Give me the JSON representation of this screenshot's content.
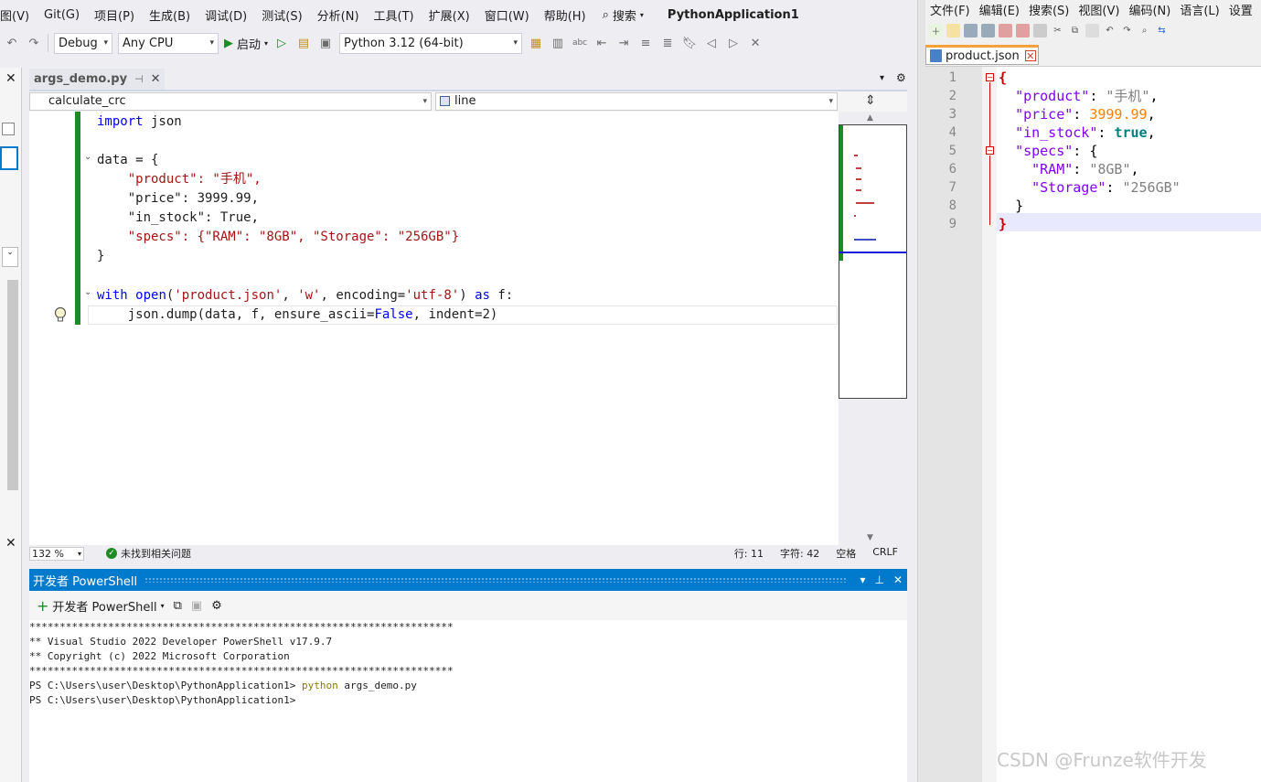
{
  "vs": {
    "menu": [
      "图(V)",
      "Git(G)",
      "项目(P)",
      "生成(B)",
      "调试(D)",
      "测试(S)",
      "分析(N)",
      "工具(T)",
      "扩展(X)",
      "窗口(W)",
      "帮助(H)"
    ],
    "search_label": "搜索",
    "solution_title": "PythonApplication1",
    "toolbar": {
      "config": "Debug",
      "platform": "Any CPU",
      "start": "启动",
      "python_env": "Python 3.12 (64-bit)"
    },
    "tab": {
      "file": "args_demo.py"
    },
    "nav": {
      "scope": "calculate_crc",
      "member": "line"
    },
    "code": {
      "l1": [
        "import",
        " json"
      ],
      "l2": "data = {",
      "l3": "    \"product\": \"手机\",",
      "l4": "    \"price\": 3999.99,",
      "l5": "    \"in_stock\": True,",
      "l6": "    \"specs\": {\"RAM\": \"8GB\", \"Storage\": \"256GB\"}",
      "l7": "}",
      "l8": [
        "with",
        " ",
        "open",
        "(",
        "'product.json'",
        ", ",
        "'w'",
        ", encoding=",
        "'utf-8'",
        ") ",
        "as",
        " f:"
      ],
      "l9": [
        "    json.dump(data, f, ensure_ascii=",
        "False",
        ", indent=2)"
      ]
    },
    "status": {
      "zoom": "132 %",
      "issues": "未找到相关问题",
      "line": "行: 11",
      "char": "字符: 42",
      "spaces": "空格",
      "eol": "CRLF"
    },
    "terminal": {
      "title": "开发者 PowerShell",
      "new_label": "开发者 PowerShell",
      "lines": [
        "**********************************************************************",
        "** Visual Studio 2022 Developer PowerShell v17.9.7",
        "** Copyright (c) 2022 Microsoft Corporation",
        "**********************************************************************"
      ],
      "prompt1": "PS C:\\Users\\user\\Desktop\\PythonApplication1> ",
      "cmd1": "python",
      "cmd1_arg": " args_demo.py",
      "prompt2": "PS C:\\Users\\user\\Desktop\\PythonApplication1>"
    }
  },
  "npp": {
    "menu": [
      "文件(F)",
      "编辑(E)",
      "搜索(S)",
      "视图(V)",
      "编码(N)",
      "语言(L)",
      "设置"
    ],
    "tab": "product.json",
    "line_numbers": [
      "1",
      "2",
      "3",
      "4",
      "5",
      "6",
      "7",
      "8",
      "9"
    ],
    "json": {
      "l1": "{",
      "l2_key": "\"product\"",
      "l2_val": "\"手机\"",
      "l3_key": "\"price\"",
      "l3_val": "3999.99",
      "l4_key": "\"in_stock\"",
      "l4_val": "true",
      "l5_key": "\"specs\"",
      "l6_key": "\"RAM\"",
      "l6_val": "\"8GB\"",
      "l7_key": "\"Storage\"",
      "l7_val": "\"256GB\"",
      "l8": "}",
      "l9": "}"
    }
  },
  "watermark": "CSDN @Frunze软件开发",
  "colors": {
    "accent": "#007acc",
    "build_green": "#1f8b24",
    "npp_tab": "#f7a13c"
  }
}
